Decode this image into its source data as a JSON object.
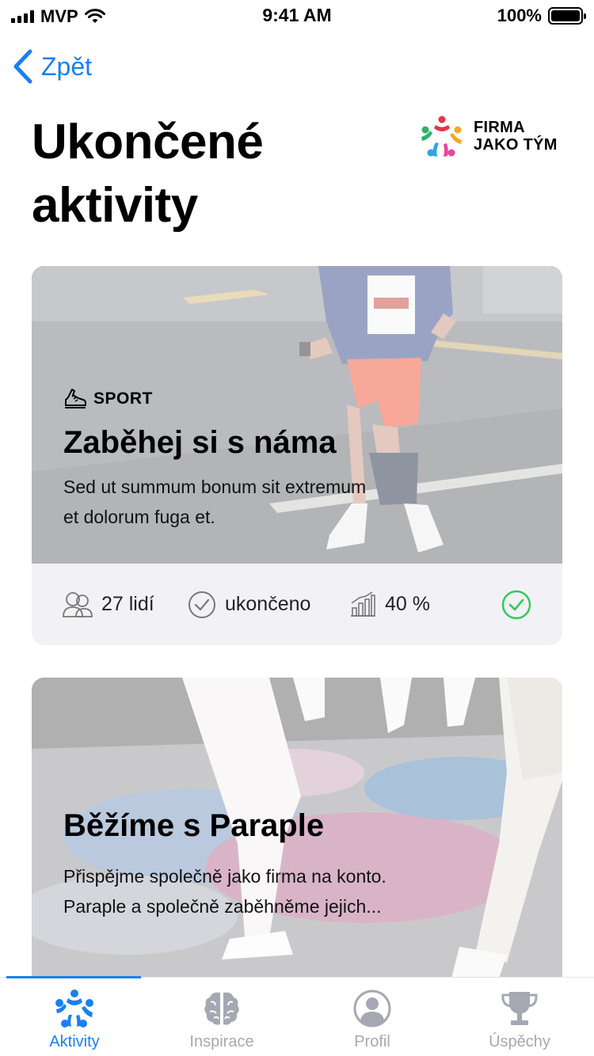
{
  "status_bar": {
    "carrier": "MVP",
    "time": "9:41 AM",
    "battery": "100%"
  },
  "nav": {
    "back_label": "Zpět"
  },
  "header": {
    "title": "Ukončené aktivity"
  },
  "logo": {
    "line1": "FIRMA",
    "line2": "JAKO TÝM"
  },
  "activities": [
    {
      "category": "SPORT",
      "title": "Zaběhej si s náma",
      "description": "Sed ut summum bonum sit extremum et dolorum fuga et.",
      "people": "27 lidí",
      "status": "ukončeno",
      "progress": "40 %",
      "completed": true
    },
    {
      "title": "Běžíme s Paraple",
      "description": "Přispějme společně jako firma na konto. Paraple a společně zaběhněme jejich..."
    }
  ],
  "tabs": [
    {
      "label": "Aktivity",
      "icon": "team-icon",
      "active": true
    },
    {
      "label": "Inspirace",
      "icon": "brain-icon",
      "active": false
    },
    {
      "label": "Profil",
      "icon": "profile-icon",
      "active": false
    },
    {
      "label": "Úspěchy",
      "icon": "trophy-icon",
      "active": false
    }
  ],
  "colors": {
    "accent": "#1a7ff0",
    "success": "#34c759",
    "inactive": "#a7a7b4"
  }
}
